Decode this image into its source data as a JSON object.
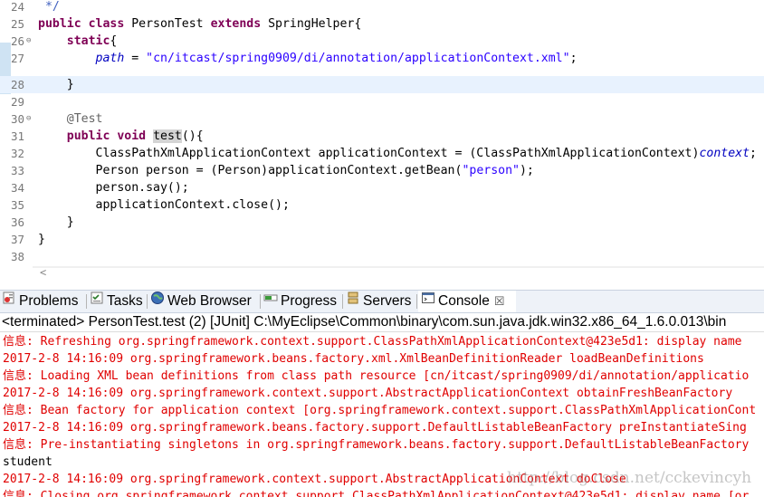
{
  "editor": {
    "lines": [
      {
        "n": "24",
        "text": " */"
      },
      {
        "n": "25",
        "text": "public class PersonTest extends SpringHelper{"
      },
      {
        "n": "26",
        "text": "    static{"
      },
      {
        "n": "27",
        "text": "        path = \"cn/itcast/spring0909/di/annotation/applicationContext.xml\";"
      },
      {
        "n": "28",
        "text": "    }"
      },
      {
        "n": "29",
        "text": ""
      },
      {
        "n": "30",
        "text": "    @Test"
      },
      {
        "n": "31",
        "text": "    public void test(){"
      },
      {
        "n": "32",
        "text": "        ClassPathXmlApplicationContext applicationContext = (ClassPathXmlApplicationContext)context;"
      },
      {
        "n": "33",
        "text": "        Person person = (Person)applicationContext.getBean(\"person\");"
      },
      {
        "n": "34",
        "text": "        person.say();"
      },
      {
        "n": "35",
        "text": "        applicationContext.close();"
      },
      {
        "n": "36",
        "text": "    }"
      },
      {
        "n": "37",
        "text": "}"
      },
      {
        "n": "38",
        "text": ""
      }
    ]
  },
  "tabs": {
    "problems": "Problems",
    "tasks": "Tasks",
    "web_browser": "Web Browser",
    "progress": "Progress",
    "servers": "Servers",
    "console": "Console",
    "close_glyph": "☒"
  },
  "console": {
    "header": "<terminated> PersonTest.test (2) [JUnit] C:\\MyEclipse\\Common\\binary\\com.sun.java.jdk.win32.x86_64_1.6.0.013\\bin",
    "lines": [
      {
        "color": "red",
        "text": "信息: Refreshing org.springframework.context.support.ClassPathXmlApplicationContext@423e5d1: display name"
      },
      {
        "color": "red",
        "text": "2017-2-8 14:16:09 org.springframework.beans.factory.xml.XmlBeanDefinitionReader loadBeanDefinitions"
      },
      {
        "color": "red",
        "text": "信息: Loading XML bean definitions from class path resource [cn/itcast/spring0909/di/annotation/applicatio"
      },
      {
        "color": "red",
        "text": "2017-2-8 14:16:09 org.springframework.context.support.AbstractApplicationContext obtainFreshBeanFactory"
      },
      {
        "color": "red",
        "text": "信息: Bean factory for application context [org.springframework.context.support.ClassPathXmlApplicationCont"
      },
      {
        "color": "red",
        "text": "2017-2-8 14:16:09 org.springframework.beans.factory.support.DefaultListableBeanFactory preInstantiateSing"
      },
      {
        "color": "red",
        "text": "信息: Pre-instantiating singletons in org.springframework.beans.factory.support.DefaultListableBeanFactory"
      },
      {
        "color": "black",
        "text": "student"
      },
      {
        "color": "red",
        "text": "2017-2-8 14:16:09 org.springframework.context.support.AbstractApplicationContext doClose"
      },
      {
        "color": "red",
        "text": "信息: Closing org.springframework.context.support.ClassPathXmlApplicationContext@423e5d1: display name [or"
      }
    ],
    "watermark": "http://blog.csdn.net/cckevincyh"
  },
  "colors": {
    "keyword": "#7f0055",
    "string": "#2a00ff",
    "field": "#0000c0",
    "annotation": "#646464",
    "console_error": "#e00000",
    "current_line": "#e8f2fe"
  }
}
